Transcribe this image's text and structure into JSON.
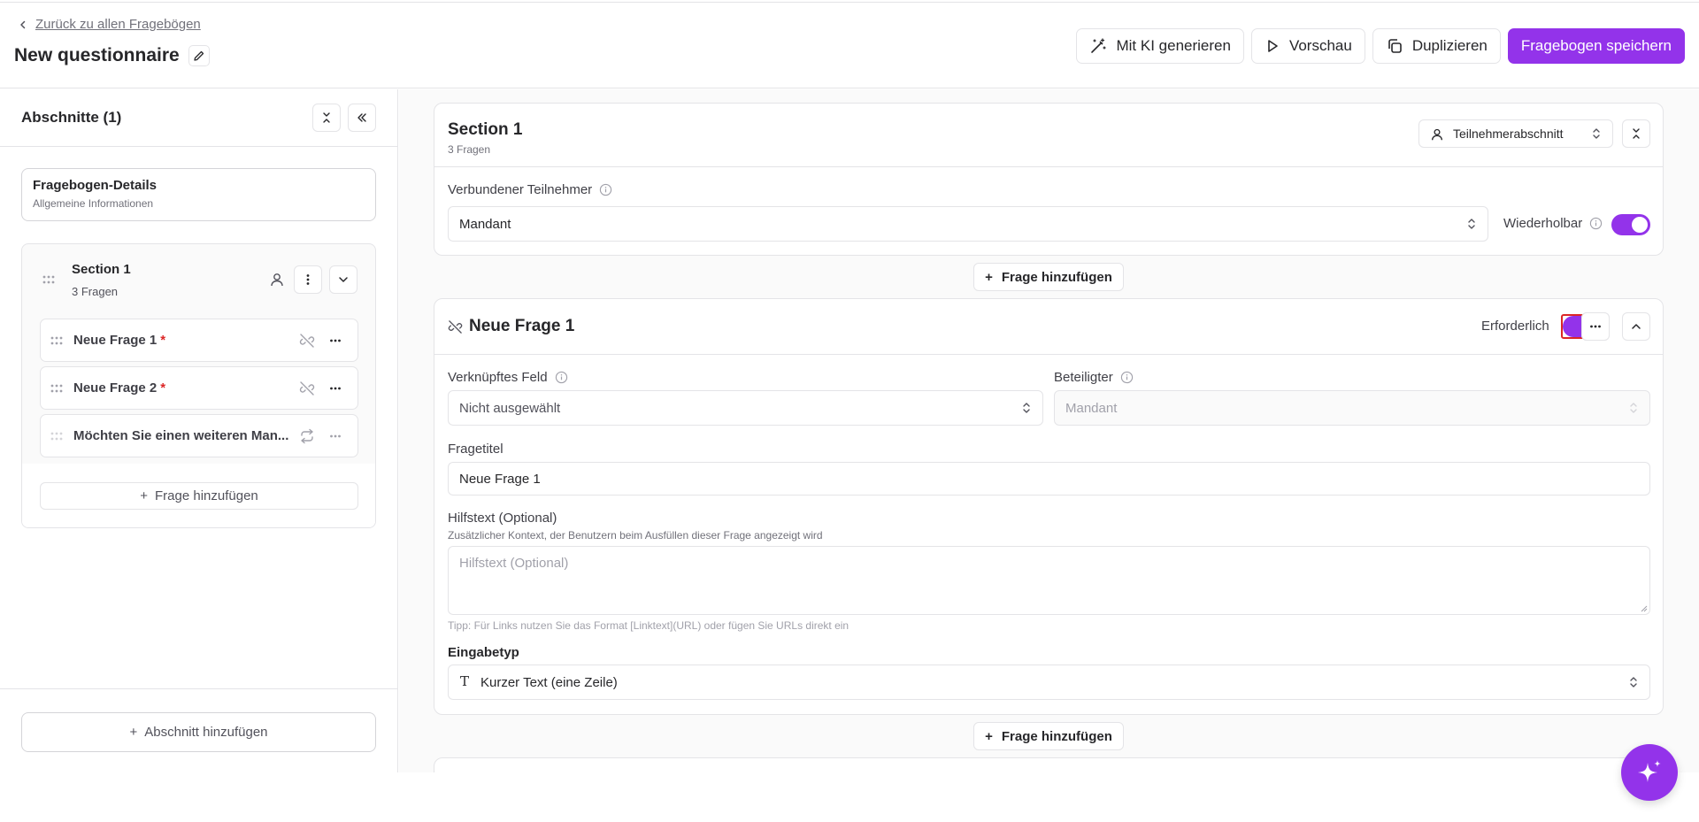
{
  "header": {
    "back_link": "Zurück zu allen Fragebögen",
    "title": "New questionnaire",
    "actions": {
      "generate_ai": "Mit KI generieren",
      "preview": "Vorschau",
      "duplicate": "Duplizieren",
      "save": "Fragebogen speichern"
    }
  },
  "sidebar": {
    "title": "Abschnitte (1)",
    "details_card": {
      "title": "Fragebogen-Details",
      "subtitle": "Allgemeine Informationen"
    },
    "section": {
      "name": "Section 1",
      "count": "3 Fragen",
      "questions": [
        {
          "label": "Neue Frage 1",
          "required": "*"
        },
        {
          "label": "Neue Frage 2",
          "required": "*"
        },
        {
          "label": "Möchten Sie einen weiteren Man..."
        }
      ],
      "add_question": "Frage hinzufügen"
    },
    "add_section": "Abschnitt hinzufügen"
  },
  "main": {
    "section_card": {
      "title": "Section 1",
      "subtitle": "3 Fragen",
      "section_type": "Teilnehmerabschnitt",
      "connected_participant_label": "Verbundener Teilnehmer",
      "connected_participant_value": "Mandant",
      "repeatable_label": "Wiederholbar",
      "repeatable_on": true
    },
    "add_question": "Frage hinzufügen",
    "question_card": {
      "title": "Neue Frage 1",
      "required_label": "Erforderlich",
      "required_on": true,
      "linked_field_label": "Verknüpftes Feld",
      "linked_field_value": "Nicht ausgewählt",
      "party_label": "Beteiligter",
      "party_value": "Mandant",
      "question_title_label": "Fragetitel",
      "question_title_value": "Neue Frage 1",
      "help_label": "Hilfstext (Optional)",
      "help_description": "Zusätzlicher Kontext, der Benutzern beim Ausfüllen dieser Frage angezeigt wird",
      "help_placeholder": "Hilfstext (Optional)",
      "tip": "Tipp: Für Links nutzen Sie das Format [Linktext](URL) oder fügen Sie URLs direkt ein",
      "input_type_label": "Eingabetyp",
      "input_type_value": "Kurzer Text (eine Zeile)"
    }
  },
  "colors": {
    "accent": "#9333ea",
    "required": "#dc2626",
    "border": "#e4e4e7",
    "focus_outline": "#dc2626"
  }
}
